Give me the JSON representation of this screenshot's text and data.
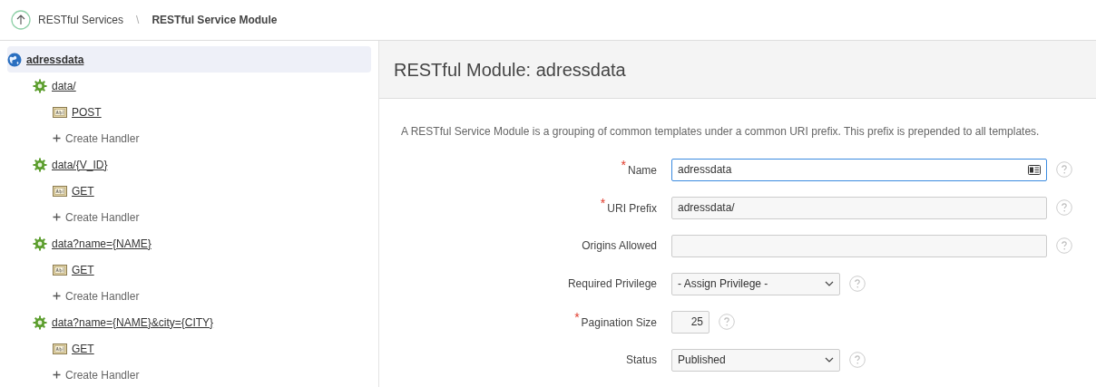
{
  "breadcrumb": {
    "items": [
      {
        "label": "RESTful Services",
        "current": false
      },
      {
        "label": "RESTful Service Module",
        "current": true
      }
    ],
    "separator": "\\"
  },
  "tree": [
    {
      "kind": "module",
      "label": "adressdata",
      "selected": true,
      "children": [
        {
          "kind": "template",
          "label": "data/",
          "selected": false,
          "children": [
            {
              "kind": "handler",
              "label": "POST",
              "selected": false
            },
            {
              "kind": "create",
              "label": "Create Handler",
              "selected": false
            }
          ]
        },
        {
          "kind": "template",
          "label": "data/{V_ID}",
          "selected": false,
          "children": [
            {
              "kind": "handler",
              "label": "GET",
              "selected": false
            },
            {
              "kind": "create",
              "label": "Create Handler",
              "selected": false
            }
          ]
        },
        {
          "kind": "template",
          "label": "data?name={NAME}",
          "selected": false,
          "children": [
            {
              "kind": "handler",
              "label": "GET",
              "selected": false
            },
            {
              "kind": "create",
              "label": "Create Handler",
              "selected": false
            }
          ]
        },
        {
          "kind": "template",
          "label": "data?name={NAME}&city={CITY}",
          "selected": false,
          "children": [
            {
              "kind": "handler",
              "label": "GET",
              "selected": false
            },
            {
              "kind": "create",
              "label": "Create Handler",
              "selected": false
            }
          ]
        }
      ]
    }
  ],
  "panel": {
    "title": "RESTful Module: adressdata",
    "description": "A RESTful Service Module is a grouping of common templates under a common URI prefix. This prefix is prepended to all templates.",
    "fields": [
      {
        "kind": "text",
        "label": "Name",
        "required_mark": "*",
        "value": "adressdata",
        "focused": true
      },
      {
        "kind": "text",
        "label": "URI Prefix",
        "required_mark": "*",
        "value": "adressdata/",
        "focused": false
      },
      {
        "kind": "text",
        "label": "Origins Allowed",
        "focused": false
      },
      {
        "kind": "select",
        "label": "Required Privilege",
        "value": "- Assign Privilege -",
        "focused": false
      },
      {
        "kind": "number",
        "label": "Pagination Size",
        "required_mark": "*",
        "value": "25",
        "focused": false
      },
      {
        "kind": "select",
        "label": "Status",
        "value": "Published",
        "focused": false
      }
    ]
  }
}
